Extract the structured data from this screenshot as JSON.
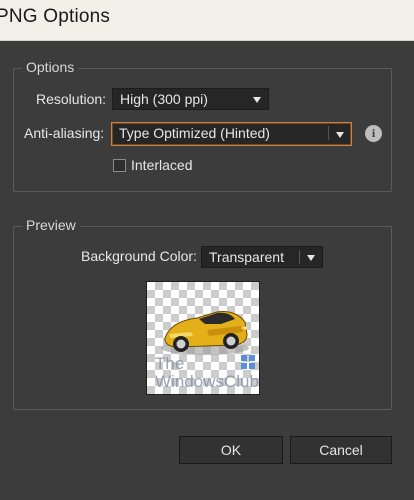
{
  "window": {
    "title": "PNG Options"
  },
  "options": {
    "legend": "Options",
    "resolution_label": "Resolution:",
    "resolution_value": "High (300 ppi)",
    "antialias_label": "Anti-aliasing:",
    "antialias_value": "Type Optimized (Hinted)",
    "interlaced_label": "Interlaced",
    "interlaced_checked": false
  },
  "preview": {
    "legend": "Preview",
    "bgcolor_label": "Background Color:",
    "bgcolor_value": "Transparent",
    "watermark_line1": "The",
    "watermark_line2": "WindowsClub"
  },
  "buttons": {
    "ok": "OK",
    "cancel": "Cancel"
  },
  "icons": {
    "info": "info-icon",
    "dropdown": "chevron-down-icon"
  },
  "colors": {
    "focus_border": "#d4803a",
    "panel_bg": "#3c3c3c",
    "field_bg": "#262626"
  }
}
